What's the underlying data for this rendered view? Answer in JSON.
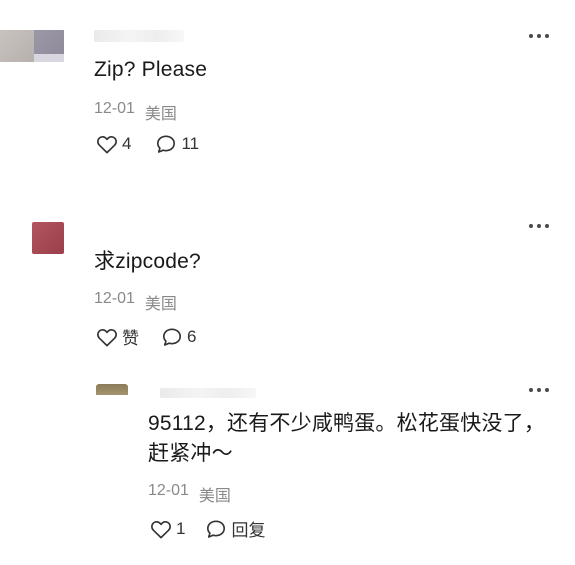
{
  "comments": [
    {
      "text": "Zip? Please",
      "date": "12-01",
      "location": "美国",
      "likes": "4",
      "replies": "11"
    },
    {
      "text": "求zipcode?",
      "date": "12-01",
      "location": "美国",
      "like_label": "赞",
      "replies": "6"
    },
    {
      "text_line1": "95112，还有不少咸鸭蛋。松花蛋快没了，",
      "text_line2": "赶紧冲～",
      "date": "12-01",
      "location": "美国",
      "likes": "1",
      "reply_label": "回复"
    }
  ],
  "icons": {
    "like": "heart-icon",
    "comment": "comment-bubble-icon",
    "more": "more-dots-icon"
  },
  "colors": {
    "text": "#1a1a1a",
    "meta": "#8a8a8a",
    "icon": "#333333"
  }
}
